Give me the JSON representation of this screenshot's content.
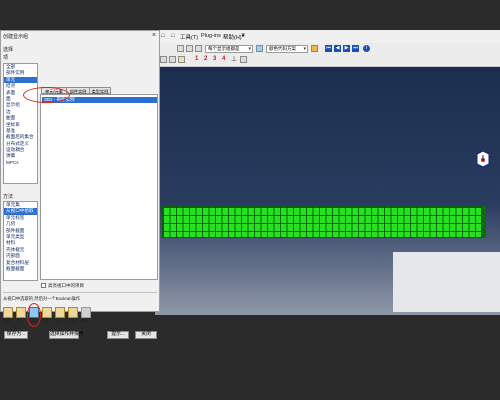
{
  "dialog": {
    "title": "创建显示组",
    "section_items_label": "选择",
    "items_label": "项",
    "items": [
      "全部",
      "部件实例",
      "单元",
      "结点",
      "表面",
      "面",
      "显示组",
      "边",
      "曲面",
      "坐标系",
      "基准",
      "截面后的集合",
      "分布式定义",
      "运动耦合",
      "弹簧",
      "MPCs"
    ],
    "selected_item_index": 2,
    "method_label": "方法",
    "methods": [
      "单元集",
      "从视口中拾取",
      "单元标签",
      "几何",
      "部件截面",
      "单元类型",
      "材料",
      "壳体截元",
      "内部面",
      "复合材料层",
      "截面截面"
    ],
    "selected_method_index": 1,
    "columns": [
      "单元/元素",
      "部件实例",
      "类型实例"
    ],
    "selected_row_text": "SB2 · 部件实例",
    "highlight_checkbox_label": "高亮视口中的项目",
    "bool_label": "从视口中选取的,然后对一个Boolean操作",
    "bool_buttons": [
      "替换",
      "添加",
      "删除",
      "相交",
      "取一个",
      "保存",
      "重排"
    ],
    "buttons": {
      "save": "保存为...",
      "replace_save": "选择操作并保存",
      "apply": "提示...",
      "close": "关闭"
    }
  },
  "main": {
    "menu": [
      "□",
      "□",
      "工具(T)",
      "Plug-ins",
      "帮助(H)",
      "❦"
    ],
    "render_combo": "每个显示组都是",
    "colorcode_combo": "颜色代码方案",
    "numbers": [
      "1",
      "2",
      "3",
      "4"
    ]
  },
  "colors": {
    "beam": "#27e021",
    "viewport_top": "#1b2e4e",
    "selection": "#2f6fd0",
    "annotation_ring": "#e0201f"
  }
}
